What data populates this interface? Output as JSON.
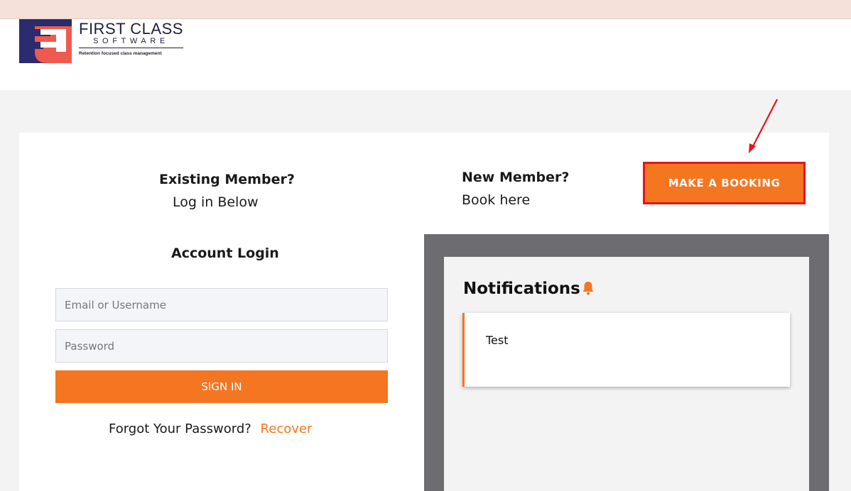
{
  "brand": {
    "name": "FIRST CLASS",
    "sub": "SOFTWARE",
    "tagline": "Retention focused class management",
    "colors": {
      "navy": "#2b2b6e",
      "coral": "#ef5a4f"
    }
  },
  "login": {
    "existing_title": "Existing Member?",
    "existing_sub": "Log in Below",
    "account_title": "Account Login",
    "email_placeholder": "Email or Username",
    "password_placeholder": "Password",
    "signin_label": "SIGN IN",
    "forgot_text": "Forgot Your Password?",
    "recover_label": "Recover"
  },
  "newmember": {
    "title": "New Member?",
    "sub": "Book here",
    "booking_label": "MAKE A BOOKING"
  },
  "notifications": {
    "title": "Notifications",
    "icon": "bell-icon",
    "items": [
      {
        "text": "Test"
      }
    ]
  },
  "colors": {
    "accent": "#f47621",
    "highlight_border": "#e8141a",
    "panel": "#6d6c71"
  }
}
